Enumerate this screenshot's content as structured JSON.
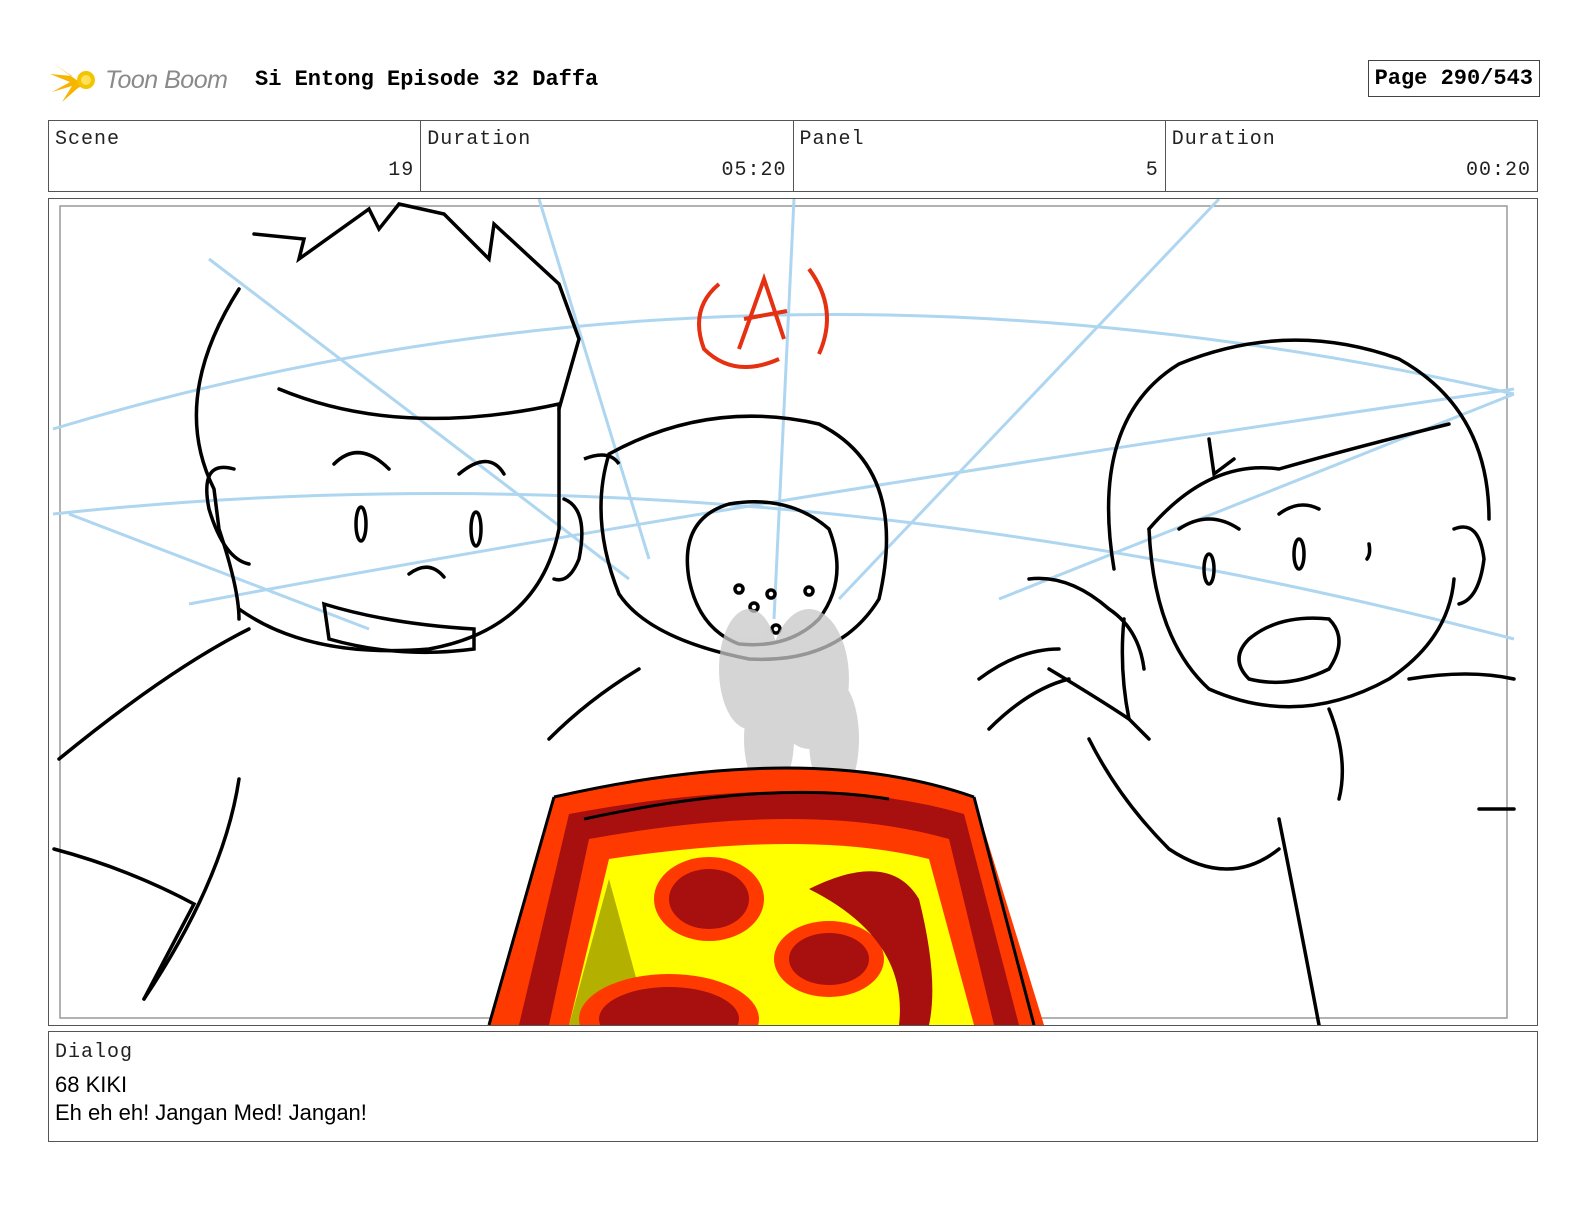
{
  "header": {
    "logo_text": "Toon Boom",
    "title": "Si Entong Episode 32 Daffa",
    "page": "Page 290/543"
  },
  "info": {
    "scene_label": "Scene",
    "scene_value": "19",
    "scene_duration_label": "Duration",
    "scene_duration_value": "05:20",
    "panel_label": "Panel",
    "panel_value": "5",
    "panel_duration_label": "Duration",
    "panel_duration_value": "00:20"
  },
  "panel_image": {
    "annotation": "(A)"
  },
  "dialog": {
    "label": "Dialog",
    "line1": "68 KIKI",
    "line2": "Eh eh eh! Jangan Med! Jangan!"
  }
}
